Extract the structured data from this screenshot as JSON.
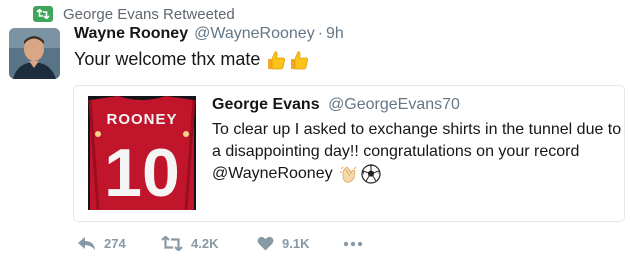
{
  "retweet_banner": {
    "text": "George Evans Retweeted",
    "icon": "retweet-icon",
    "color": "#3fa55b"
  },
  "tweet": {
    "display_name": "Wayne Rooney",
    "handle": "@WayneRooney",
    "separator": "·",
    "time": "9h",
    "text": "Your welcome thx mate",
    "emojis": [
      "thumbs-up-icon",
      "thumbs-up-icon"
    ]
  },
  "quoted_tweet": {
    "display_name": "George Evans",
    "handle": "@GeorgeEvans70",
    "lines": [
      "To clear up I asked to exchange shirts in the tunnel due to",
      "a disappointing day!! congratulations on your record",
      "@WayneRooney"
    ],
    "emojis": [
      "clapping-hands-icon",
      "soccer-ball-icon"
    ],
    "image": {
      "shirt_name": "ROONEY",
      "shirt_number": "10",
      "shirt_color": "#c0152a"
    }
  },
  "actions": {
    "reply_count": "274",
    "retweet_count": "4.2K",
    "like_count": "9.1K",
    "more_icon": "more-dots-icon"
  }
}
